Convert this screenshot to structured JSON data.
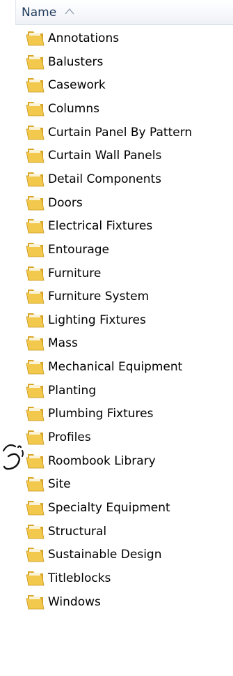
{
  "header": {
    "name_label": "Name",
    "sort_icon": "sort-ascending-icon"
  },
  "folders": [
    {
      "label": "Annotations"
    },
    {
      "label": "Balusters"
    },
    {
      "label": "Casework"
    },
    {
      "label": "Columns"
    },
    {
      "label": "Curtain Panel By Pattern"
    },
    {
      "label": "Curtain Wall Panels"
    },
    {
      "label": "Detail Components"
    },
    {
      "label": "Doors"
    },
    {
      "label": "Electrical Fixtures"
    },
    {
      "label": "Entourage"
    },
    {
      "label": "Furniture"
    },
    {
      "label": "Furniture System"
    },
    {
      "label": "Lighting Fixtures"
    },
    {
      "label": "Mass"
    },
    {
      "label": "Mechanical Equipment"
    },
    {
      "label": "Planting"
    },
    {
      "label": "Plumbing Fixtures"
    },
    {
      "label": "Profiles"
    },
    {
      "label": "Roombook Library"
    },
    {
      "label": "Site"
    },
    {
      "label": "Specialty Equipment"
    },
    {
      "label": "Structural"
    },
    {
      "label": "Sustainable Design"
    },
    {
      "label": "Titleblocks"
    },
    {
      "label": "Windows"
    }
  ],
  "icon": "folder-icon",
  "colors": {
    "header_text": "#1e395b",
    "folder_front": "#f2c94c",
    "folder_back": "#d9a627"
  }
}
